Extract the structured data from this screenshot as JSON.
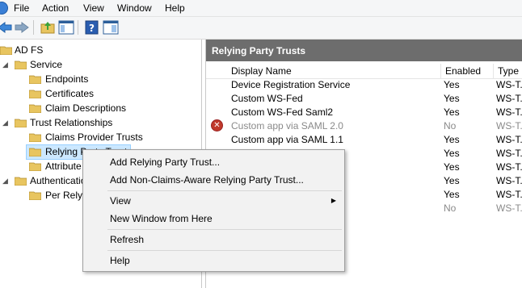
{
  "menubar": {
    "items": [
      "File",
      "Action",
      "View",
      "Window",
      "Help"
    ]
  },
  "toolbar": {
    "buttons": [
      "back-icon",
      "forward-icon",
      "up-folder-icon",
      "show-hide-tree-icon",
      "help-icon",
      "properties-icon"
    ]
  },
  "tree": {
    "root": "AD FS",
    "service": "Service",
    "endpoints": "Endpoints",
    "certificates": "Certificates",
    "claim_descriptions": "Claim Descriptions",
    "trust_relationships": "Trust Relationships",
    "claims_provider_trusts": "Claims Provider Trusts",
    "relying_party_trusts": "Relying Party Trust",
    "attribute_stores": "Attribute",
    "authentication": "Authenticatio",
    "per_relying": "Per Relyi"
  },
  "pane": {
    "title": "Relying Party Trusts",
    "columns": {
      "display_name": "Display Name",
      "enabled": "Enabled",
      "type": "Type"
    },
    "rows": [
      {
        "name": "Device Registration Service",
        "enabled": "Yes",
        "type": "WS-T..."
      },
      {
        "name": "Custom WS-Fed",
        "enabled": "Yes",
        "type": "WS-T..."
      },
      {
        "name": "Custom WS-Fed Saml2",
        "enabled": "Yes",
        "type": "WS-T..."
      },
      {
        "name": "Custom app via SAML 2.0",
        "enabled": "No",
        "type": "WS-T..."
      },
      {
        "name": "Custom app via SAML 1.1",
        "enabled": "Yes",
        "type": "WS-T..."
      },
      {
        "name": "",
        "enabled": "Yes",
        "type": "WS-T..."
      },
      {
        "name": "",
        "enabled": "Yes",
        "type": "WS-T..."
      },
      {
        "name": "",
        "enabled": "Yes",
        "type": "WS-T..."
      },
      {
        "name": "",
        "enabled": "Yes",
        "type": "WS-T..."
      },
      {
        "name": "",
        "enabled": "No",
        "type": "WS-T..."
      }
    ]
  },
  "context_menu": {
    "add_rp": "Add Relying Party Trust...",
    "add_non_claims": "Add Non-Claims-Aware Relying Party Trust...",
    "view": "View",
    "new_window": "New Window from Here",
    "refresh": "Refresh",
    "help": "Help"
  }
}
